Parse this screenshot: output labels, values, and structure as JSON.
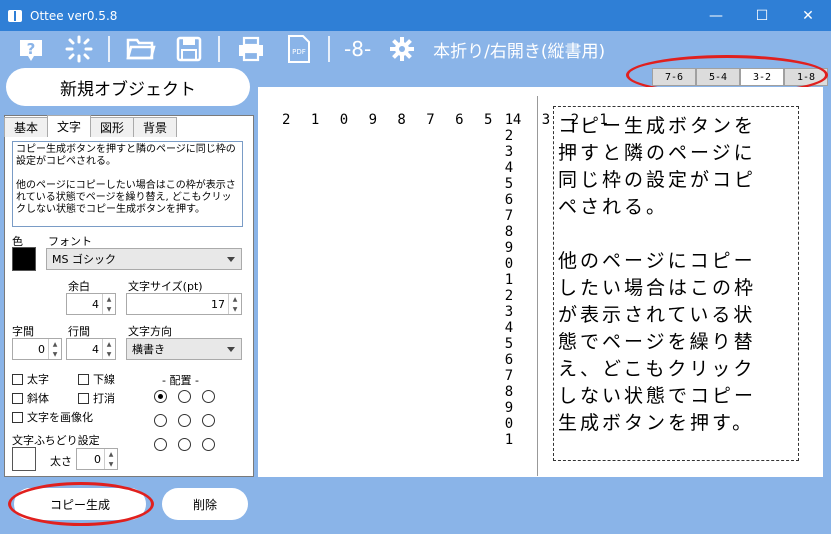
{
  "window": {
    "title": "Ottee ver0.5.8"
  },
  "toolbar": {
    "page_indicator": "-8-",
    "mode_label": "本折り/右開き(縦書用)"
  },
  "page_tabs": [
    {
      "label": "7-6"
    },
    {
      "label": "5-4"
    },
    {
      "label": "3-2"
    },
    {
      "label": "1-8"
    }
  ],
  "new_object_label": "新規オブジェクト",
  "tabs": [
    {
      "label": "基本"
    },
    {
      "label": "文字"
    },
    {
      "label": "図形"
    },
    {
      "label": "背景"
    }
  ],
  "text_content": "コピー生成ボタンを押すと隣のページに同じ枠の設定がコピペされる。\n\n他のページにコピーしたい場合はこの枠が表示されている状態でページを繰り替え, どこもクリックしない状態でコピー生成ボタンを押す。",
  "labels": {
    "color": "色",
    "font": "フォント",
    "margin": "余白",
    "font_size": "文字サイズ(pt)",
    "char_spacing": "字間",
    "line_spacing": "行間",
    "direction": "文字方向",
    "bold": "太字",
    "underline": "下線",
    "italic": "斜体",
    "strike": "打消",
    "rasterize": "文字を画像化",
    "alignment": "- 配置 -",
    "outline": "文字ふちどり設定",
    "thickness": "太さ"
  },
  "values": {
    "font": "MS ゴシック",
    "margin": "4",
    "font_size": "17",
    "char_spacing": "0",
    "line_spacing": "4",
    "direction": "横書き",
    "thickness": "0"
  },
  "buttons": {
    "copy": "コピー生成",
    "delete": "削除"
  },
  "canvas": {
    "column_numbers": "2 1 0 9 8 7 6 5 4 3 2 1",
    "row_numbers": [
      "1",
      "2",
      "3",
      "4",
      "5",
      "6",
      "7",
      "8",
      "9",
      "0",
      "1",
      "2",
      "3",
      "4",
      "5",
      "6",
      "7",
      "8",
      "9",
      "0",
      "1"
    ],
    "frame_text": "コピー生成ボタンを\n押すと隣のページに\n同じ枠の設定がコピ\nペされる。\n\n他のページにコピー\nしたい場合はこの枠\nが表示されている状\n態でページを繰り替\nえ、どこもクリック\nしない状態でコピー\n生成ボタンを押す。"
  },
  "colors": {
    "accent": "#2f7fd6",
    "toolbar_bg": "#8ab4e8",
    "annotation": "#e0201e"
  }
}
